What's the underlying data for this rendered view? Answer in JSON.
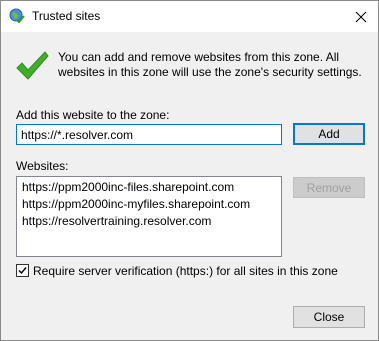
{
  "window": {
    "title": "Trusted sites",
    "icon": "globe-check-icon",
    "close_icon": "close-icon"
  },
  "info": {
    "icon": "green-checkmark-icon",
    "text": "You can add and remove websites from this zone. All websites in this zone will use the zone's security settings."
  },
  "add_section": {
    "label": "Add this website to the zone:",
    "input_value": "https://*.resolver.com",
    "add_button": "Add"
  },
  "websites_section": {
    "label": "Websites:",
    "items": [
      "https://ppm2000inc-files.sharepoint.com",
      "https://ppm2000inc-myfiles.sharepoint.com",
      "https://resolvertraining.resolver.com"
    ],
    "remove_button": "Remove"
  },
  "verification": {
    "checked": true,
    "label": "Require server verification (https:) for all sites in this zone"
  },
  "footer": {
    "close_button": "Close"
  },
  "colors": {
    "accent": "#0078d7",
    "check_green": "#3fae29",
    "dialog_bg": "#f0f0f0"
  }
}
